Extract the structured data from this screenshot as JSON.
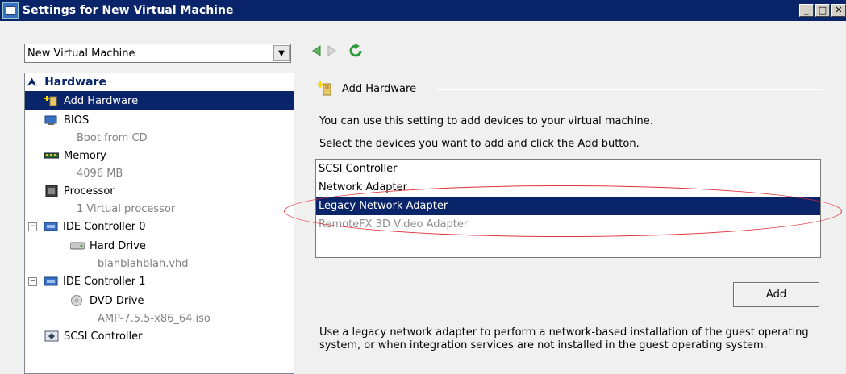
{
  "window": {
    "title": "Settings for New Virtual Machine"
  },
  "vm_selector": {
    "value": "New Virtual Machine"
  },
  "tree": {
    "section": "Hardware",
    "items": [
      {
        "label": "Add Hardware",
        "sub": ""
      },
      {
        "label": "BIOS",
        "sub": "Boot from CD"
      },
      {
        "label": "Memory",
        "sub": "4096 MB"
      },
      {
        "label": "Processor",
        "sub": "1 Virtual processor"
      },
      {
        "label": "IDE Controller 0",
        "sub": ""
      },
      {
        "label": "Hard Drive",
        "sub": "blahblahblah.vhd"
      },
      {
        "label": "IDE Controller 1",
        "sub": ""
      },
      {
        "label": "DVD Drive",
        "sub": "AMP-7.5.5-x86_64.iso"
      },
      {
        "label": "SCSI Controller",
        "sub": ""
      }
    ]
  },
  "panel": {
    "group_title": "Add Hardware",
    "desc1": "You can use this setting to add devices to your virtual machine.",
    "desc2": "Select the devices you want to add and click the Add button.",
    "devices": [
      "SCSI Controller",
      "Network Adapter",
      "Legacy Network Adapter",
      "RemoteFX 3D Video Adapter"
    ],
    "add_label": "Add",
    "help": "Use a legacy network adapter to perform a network-based installation of the guest operating system, or when integration services are not installed in the guest operating system."
  },
  "colors": {
    "selection": "#0a246a",
    "annotation": "#e0303a"
  },
  "icons": [
    "add-hardware-icon",
    "bios-icon",
    "memory-icon",
    "processor-icon",
    "ide-controller-icon",
    "hard-drive-icon",
    "dvd-drive-icon",
    "scsi-controller-icon",
    "back-arrow-icon",
    "forward-arrow-icon",
    "refresh-icon"
  ]
}
